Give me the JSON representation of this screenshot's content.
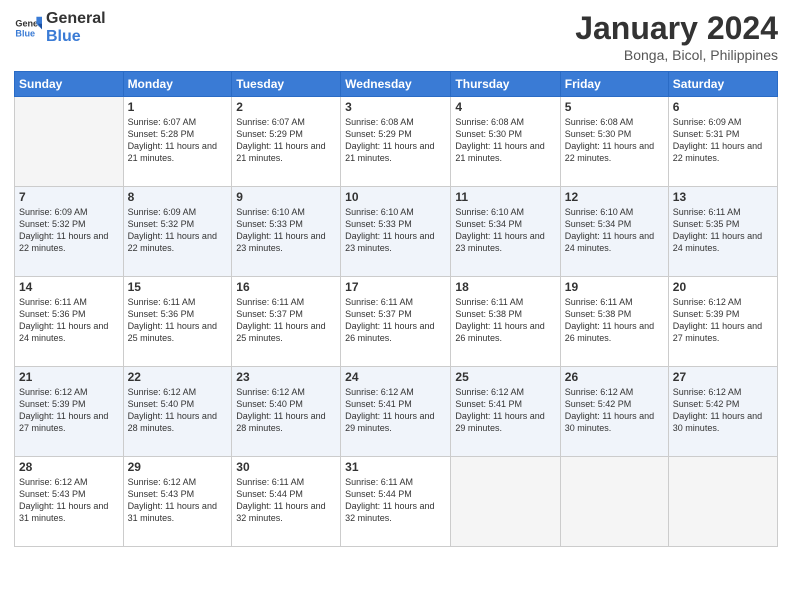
{
  "header": {
    "logo": {
      "general": "General",
      "blue": "Blue"
    },
    "title": "January 2024",
    "location": "Bonga, Bicol, Philippines"
  },
  "days_of_week": [
    "Sunday",
    "Monday",
    "Tuesday",
    "Wednesday",
    "Thursday",
    "Friday",
    "Saturday"
  ],
  "weeks": [
    [
      {
        "day": "",
        "sunrise": "",
        "sunset": "",
        "daylight": ""
      },
      {
        "day": "1",
        "sunrise": "Sunrise: 6:07 AM",
        "sunset": "Sunset: 5:28 PM",
        "daylight": "Daylight: 11 hours and 21 minutes."
      },
      {
        "day": "2",
        "sunrise": "Sunrise: 6:07 AM",
        "sunset": "Sunset: 5:29 PM",
        "daylight": "Daylight: 11 hours and 21 minutes."
      },
      {
        "day": "3",
        "sunrise": "Sunrise: 6:08 AM",
        "sunset": "Sunset: 5:29 PM",
        "daylight": "Daylight: 11 hours and 21 minutes."
      },
      {
        "day": "4",
        "sunrise": "Sunrise: 6:08 AM",
        "sunset": "Sunset: 5:30 PM",
        "daylight": "Daylight: 11 hours and 21 minutes."
      },
      {
        "day": "5",
        "sunrise": "Sunrise: 6:08 AM",
        "sunset": "Sunset: 5:30 PM",
        "daylight": "Daylight: 11 hours and 22 minutes."
      },
      {
        "day": "6",
        "sunrise": "Sunrise: 6:09 AM",
        "sunset": "Sunset: 5:31 PM",
        "daylight": "Daylight: 11 hours and 22 minutes."
      }
    ],
    [
      {
        "day": "7",
        "sunrise": "Sunrise: 6:09 AM",
        "sunset": "Sunset: 5:32 PM",
        "daylight": "Daylight: 11 hours and 22 minutes."
      },
      {
        "day": "8",
        "sunrise": "Sunrise: 6:09 AM",
        "sunset": "Sunset: 5:32 PM",
        "daylight": "Daylight: 11 hours and 22 minutes."
      },
      {
        "day": "9",
        "sunrise": "Sunrise: 6:10 AM",
        "sunset": "Sunset: 5:33 PM",
        "daylight": "Daylight: 11 hours and 23 minutes."
      },
      {
        "day": "10",
        "sunrise": "Sunrise: 6:10 AM",
        "sunset": "Sunset: 5:33 PM",
        "daylight": "Daylight: 11 hours and 23 minutes."
      },
      {
        "day": "11",
        "sunrise": "Sunrise: 6:10 AM",
        "sunset": "Sunset: 5:34 PM",
        "daylight": "Daylight: 11 hours and 23 minutes."
      },
      {
        "day": "12",
        "sunrise": "Sunrise: 6:10 AM",
        "sunset": "Sunset: 5:34 PM",
        "daylight": "Daylight: 11 hours and 24 minutes."
      },
      {
        "day": "13",
        "sunrise": "Sunrise: 6:11 AM",
        "sunset": "Sunset: 5:35 PM",
        "daylight": "Daylight: 11 hours and 24 minutes."
      }
    ],
    [
      {
        "day": "14",
        "sunrise": "Sunrise: 6:11 AM",
        "sunset": "Sunset: 5:36 PM",
        "daylight": "Daylight: 11 hours and 24 minutes."
      },
      {
        "day": "15",
        "sunrise": "Sunrise: 6:11 AM",
        "sunset": "Sunset: 5:36 PM",
        "daylight": "Daylight: 11 hours and 25 minutes."
      },
      {
        "day": "16",
        "sunrise": "Sunrise: 6:11 AM",
        "sunset": "Sunset: 5:37 PM",
        "daylight": "Daylight: 11 hours and 25 minutes."
      },
      {
        "day": "17",
        "sunrise": "Sunrise: 6:11 AM",
        "sunset": "Sunset: 5:37 PM",
        "daylight": "Daylight: 11 hours and 26 minutes."
      },
      {
        "day": "18",
        "sunrise": "Sunrise: 6:11 AM",
        "sunset": "Sunset: 5:38 PM",
        "daylight": "Daylight: 11 hours and 26 minutes."
      },
      {
        "day": "19",
        "sunrise": "Sunrise: 6:11 AM",
        "sunset": "Sunset: 5:38 PM",
        "daylight": "Daylight: 11 hours and 26 minutes."
      },
      {
        "day": "20",
        "sunrise": "Sunrise: 6:12 AM",
        "sunset": "Sunset: 5:39 PM",
        "daylight": "Daylight: 11 hours and 27 minutes."
      }
    ],
    [
      {
        "day": "21",
        "sunrise": "Sunrise: 6:12 AM",
        "sunset": "Sunset: 5:39 PM",
        "daylight": "Daylight: 11 hours and 27 minutes."
      },
      {
        "day": "22",
        "sunrise": "Sunrise: 6:12 AM",
        "sunset": "Sunset: 5:40 PM",
        "daylight": "Daylight: 11 hours and 28 minutes."
      },
      {
        "day": "23",
        "sunrise": "Sunrise: 6:12 AM",
        "sunset": "Sunset: 5:40 PM",
        "daylight": "Daylight: 11 hours and 28 minutes."
      },
      {
        "day": "24",
        "sunrise": "Sunrise: 6:12 AM",
        "sunset": "Sunset: 5:41 PM",
        "daylight": "Daylight: 11 hours and 29 minutes."
      },
      {
        "day": "25",
        "sunrise": "Sunrise: 6:12 AM",
        "sunset": "Sunset: 5:41 PM",
        "daylight": "Daylight: 11 hours and 29 minutes."
      },
      {
        "day": "26",
        "sunrise": "Sunrise: 6:12 AM",
        "sunset": "Sunset: 5:42 PM",
        "daylight": "Daylight: 11 hours and 30 minutes."
      },
      {
        "day": "27",
        "sunrise": "Sunrise: 6:12 AM",
        "sunset": "Sunset: 5:42 PM",
        "daylight": "Daylight: 11 hours and 30 minutes."
      }
    ],
    [
      {
        "day": "28",
        "sunrise": "Sunrise: 6:12 AM",
        "sunset": "Sunset: 5:43 PM",
        "daylight": "Daylight: 11 hours and 31 minutes."
      },
      {
        "day": "29",
        "sunrise": "Sunrise: 6:12 AM",
        "sunset": "Sunset: 5:43 PM",
        "daylight": "Daylight: 11 hours and 31 minutes."
      },
      {
        "day": "30",
        "sunrise": "Sunrise: 6:11 AM",
        "sunset": "Sunset: 5:44 PM",
        "daylight": "Daylight: 11 hours and 32 minutes."
      },
      {
        "day": "31",
        "sunrise": "Sunrise: 6:11 AM",
        "sunset": "Sunset: 5:44 PM",
        "daylight": "Daylight: 11 hours and 32 minutes."
      },
      {
        "day": "",
        "sunrise": "",
        "sunset": "",
        "daylight": ""
      },
      {
        "day": "",
        "sunrise": "",
        "sunset": "",
        "daylight": ""
      },
      {
        "day": "",
        "sunrise": "",
        "sunset": "",
        "daylight": ""
      }
    ]
  ]
}
